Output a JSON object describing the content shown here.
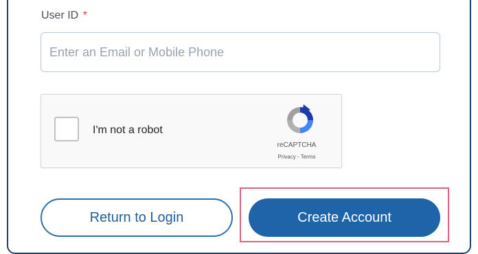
{
  "form": {
    "user_id_label": "User ID",
    "required_marker": "*",
    "user_id_value": "",
    "user_id_placeholder": "Enter an Email or Mobile Phone"
  },
  "captcha": {
    "checkbox_label": "I'm not a robot",
    "brand": "reCAPTCHA",
    "links": "Privacy - Terms",
    "logo_icon": "recaptcha-logo-icon"
  },
  "actions": {
    "return_label": "Return to Login",
    "create_label": "Create Account"
  },
  "colors": {
    "primary": "#1d64a8",
    "required": "#d93a3a",
    "highlight": "#e0627a"
  }
}
